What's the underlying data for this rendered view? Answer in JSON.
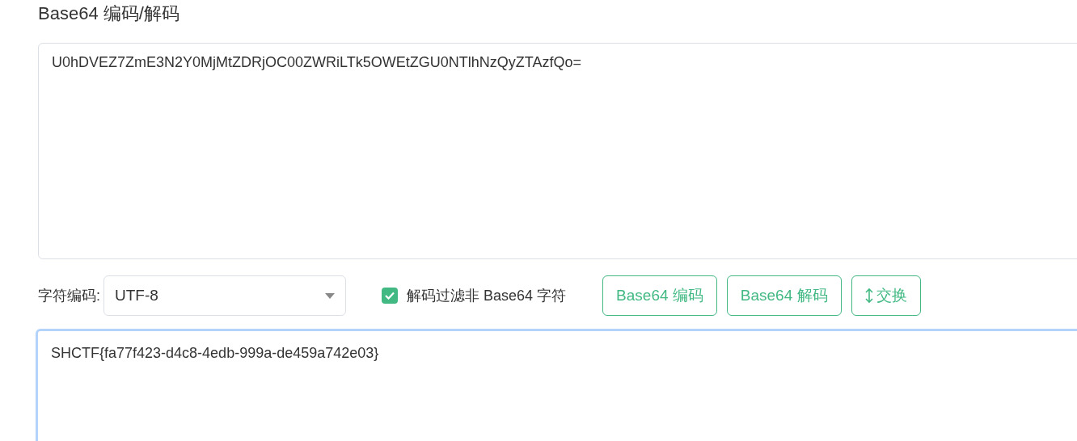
{
  "title": "Base64 编码/解码",
  "input": {
    "value": "U0hDVEZ7ZmE3N2Y0MjMtZDRjOC00ZWRiLTk5OWEtZGU0NTlhNzQyZTAzfQo="
  },
  "charset": {
    "label": "字符编码:",
    "value": "UTF-8"
  },
  "filter": {
    "label": "解码过滤非 Base64 字符",
    "checked": true
  },
  "buttons": [
    {
      "label": "Base64 编码",
      "kind": "plain"
    },
    {
      "label": "Base64 解码",
      "kind": "plain"
    },
    {
      "label": "交换",
      "kind": "swap"
    }
  ],
  "output": {
    "value": "SHCTF{fa77f423-d4c8-4edb-999a-de459a742e03}",
    "focused": true
  }
}
